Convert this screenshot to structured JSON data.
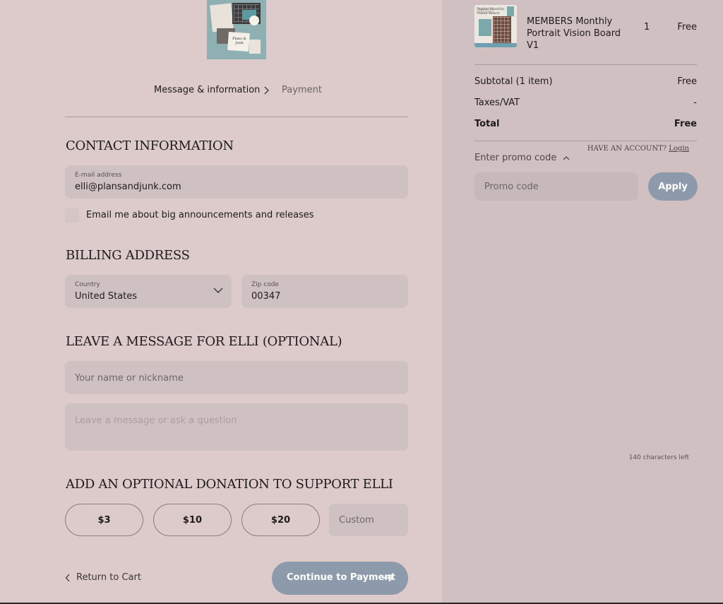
{
  "logo": {
    "alt_text": "Plans & Junk"
  },
  "breadcrumb": {
    "step1": "Message & information",
    "step2": "Payment"
  },
  "contact": {
    "title": "Contact information",
    "have_account": "Have an account?",
    "login": "Login",
    "email_label": "E-mail address",
    "email_value": "elli@plansandjunk.com",
    "newsletter_label": "Email me about big announcements and releases",
    "newsletter_checked": false
  },
  "billing": {
    "title": "Billing address",
    "country_label": "Country",
    "country_value": "United States",
    "zip_label": "Zip code",
    "zip_value": "00347"
  },
  "message": {
    "title": "Leave a message for Elli (optional)",
    "name_placeholder": "Your name or nickname",
    "message_placeholder": "Leave a message or ask a question",
    "chars_left": "140 characters left"
  },
  "donation": {
    "title": "Add an optional donation to support Elli",
    "options": [
      "$3",
      "$10",
      "$20"
    ],
    "custom_placeholder": "Custom"
  },
  "footer": {
    "return_label": "Return to Cart",
    "continue_label": "Continue to Payment"
  },
  "order": {
    "product_thumb_text": "Digital Monthly Vision Board",
    "product_name": "MEMBERS Monthly Portrait Vision Board V1",
    "quantity": "1",
    "price": "Free",
    "subtotal_label": "Subtotal (1 item)",
    "subtotal_value": "Free",
    "taxes_label": "Taxes/VAT",
    "taxes_value": "-",
    "total_label": "Total",
    "total_value": "Free",
    "promo_toggle": "Enter promo code",
    "promo_placeholder": "Promo code",
    "apply_label": "Apply"
  },
  "colors": {
    "left_bg": "#dccbca",
    "right_bg": "#d1c0c1",
    "field_bg": "#cfc1c1",
    "accent_button": "#8c9aab"
  }
}
